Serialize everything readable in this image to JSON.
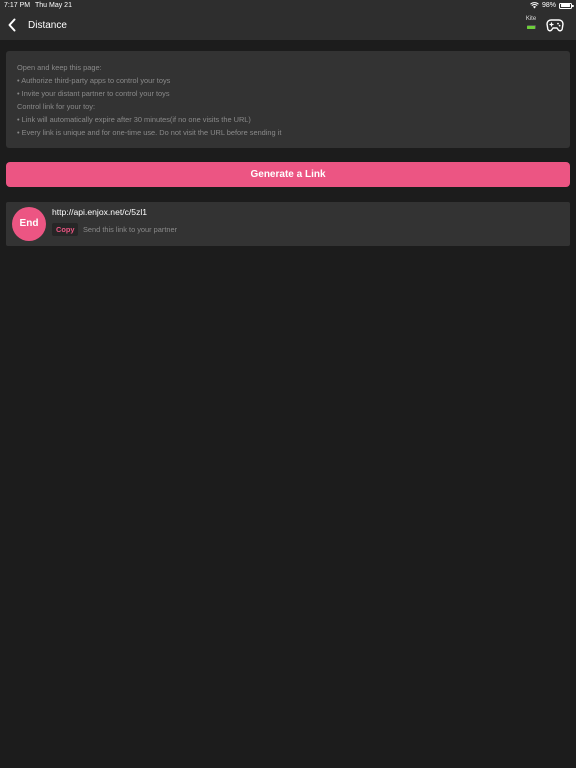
{
  "status_bar": {
    "time": "7:17 PM",
    "date": "Thu May 21",
    "battery_percent": "98%",
    "battery_level": 0.98,
    "icons": [
      "wifi-icon",
      "battery-icon"
    ]
  },
  "nav": {
    "title": "Distance",
    "back_icon": "chevron-left-icon",
    "toy_name": "Kite",
    "toy_battery_icon": "battery-icon",
    "gamepad_icon": "gamepad-icon"
  },
  "info": {
    "lines": [
      "Open and keep this page:",
      "• Authorize third-party apps to control your toys",
      "• Invite your distant partner to control your toys",
      "Control link for your toy:",
      "• Link will automatically expire after 30 minutes(if no one visits the URL)",
      "• Every link is unique and for one-time use. Do not visit the URL before sending it"
    ]
  },
  "generate_button": "Generate a Link",
  "link": {
    "end_label": "End",
    "url": "http://api.enjox.net/c/5zl1",
    "copy_label": "Copy",
    "hint": "Send this link to your partner"
  },
  "colors": {
    "accent": "#ec5583",
    "background": "#1c1c1c",
    "bar": "#2e2e2e",
    "card": "#333333",
    "muted_text": "#8a8a8a",
    "toy_battery": "#6dcf3a"
  }
}
